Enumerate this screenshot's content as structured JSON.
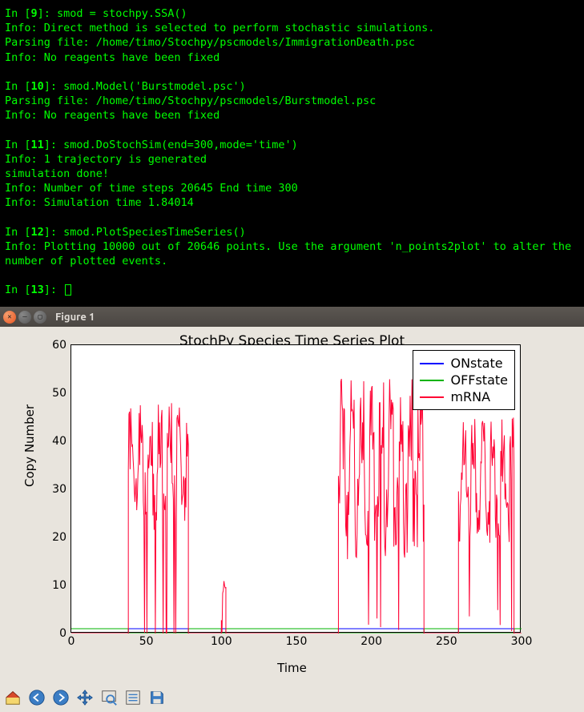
{
  "terminal": {
    "cells": [
      {
        "n": "9",
        "code": "smod = stochpy.SSA()",
        "out": [
          "Info: Direct method is selected to perform stochastic simulations.",
          "Parsing file: /home/timo/Stochpy/pscmodels/ImmigrationDeath.psc",
          "Info: No reagents have been fixed"
        ]
      },
      {
        "n": "10",
        "code": "smod.Model('Burstmodel.psc')",
        "out": [
          "Parsing file: /home/timo/Stochpy/pscmodels/Burstmodel.psc",
          "Info: No reagents have been fixed"
        ]
      },
      {
        "n": "11",
        "code": "smod.DoStochSim(end=300,mode='time')",
        "out": [
          "Info: 1 trajectory is generated",
          "simulation done!",
          "Info: Number of time steps 20645 End time 300",
          "Info: Simulation time 1.84014"
        ]
      },
      {
        "n": "12",
        "code": "smod.PlotSpeciesTimeSeries()",
        "out": [
          "Info: Plotting 10000 out of 20646 points. Use the argument 'n_points2plot' to alter the number of plotted events."
        ]
      }
    ],
    "next_prompt": "13"
  },
  "window": {
    "title": "Figure 1"
  },
  "chart_data": {
    "type": "line",
    "title": "StochPy Species Time Series Plot",
    "xlabel": "Time",
    "ylabel": "Copy Number",
    "xlim": [
      0,
      300
    ],
    "ylim": [
      0,
      60
    ],
    "x_ticks": [
      0,
      50,
      100,
      150,
      200,
      250,
      300
    ],
    "y_ticks": [
      0,
      10,
      20,
      30,
      40,
      50,
      60
    ],
    "series": [
      {
        "name": "ONstate",
        "color": "#0000ff",
        "segments": [
          [
            0,
            0
          ],
          [
            38,
            0
          ],
          [
            38,
            1
          ],
          [
            78,
            1
          ],
          [
            78,
            0
          ],
          [
            100,
            0
          ],
          [
            100,
            1
          ],
          [
            103,
            1
          ],
          [
            103,
            0
          ],
          [
            178,
            0
          ],
          [
            178,
            1
          ],
          [
            235,
            1
          ],
          [
            235,
            0
          ],
          [
            258,
            0
          ],
          [
            258,
            1
          ],
          [
            295,
            1
          ],
          [
            295,
            0
          ],
          [
            300,
            0
          ]
        ]
      },
      {
        "name": "OFFstate",
        "color": "#00b300",
        "segments": [
          [
            0,
            1
          ],
          [
            38,
            1
          ],
          [
            38,
            0
          ],
          [
            78,
            0
          ],
          [
            78,
            1
          ],
          [
            100,
            1
          ],
          [
            100,
            0
          ],
          [
            103,
            0
          ],
          [
            103,
            1
          ],
          [
            178,
            1
          ],
          [
            178,
            0
          ],
          [
            235,
            0
          ],
          [
            235,
            1
          ],
          [
            258,
            1
          ],
          [
            258,
            0
          ],
          [
            295,
            0
          ],
          [
            295,
            1
          ],
          [
            300,
            1
          ]
        ]
      },
      {
        "name": "mRNA",
        "color": "#ff0033",
        "burst_ranges": [
          [
            38,
            78,
            20,
            48
          ],
          [
            100,
            103,
            0,
            12
          ],
          [
            178,
            235,
            15,
            53
          ],
          [
            258,
            295,
            18,
            45
          ]
        ]
      }
    ]
  },
  "toolbar": {
    "buttons": [
      "home",
      "back",
      "forward",
      "pan",
      "zoom",
      "configure",
      "save"
    ]
  }
}
